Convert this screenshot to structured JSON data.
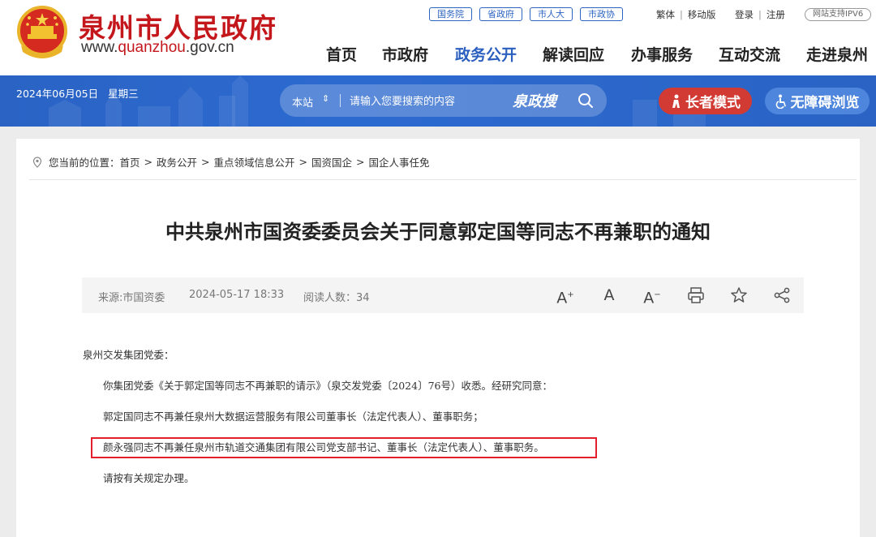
{
  "header": {
    "site_name": "泉州市人民政府",
    "site_url_prefix": "www.",
    "site_url_domain": "quanzhou",
    "site_url_suffix": ".gov.cn",
    "top_links": [
      "国务院",
      "省政府",
      "市人大",
      "市政协"
    ],
    "util_links": {
      "traditional": "繁体",
      "mobile": "移动版",
      "login": "登录",
      "register": "注册",
      "ipv6": "网站支持IPV6"
    },
    "nav": [
      "首页",
      "市政府",
      "政务公开",
      "解读回应",
      "办事服务",
      "互动交流",
      "走进泉州"
    ],
    "active_nav": "政务公开"
  },
  "banner": {
    "date": "2024年06月05日",
    "weekday": "星期三",
    "search": {
      "scope": "本站",
      "placeholder": "请输入您要搜索的内容",
      "brand": "泉政搜"
    },
    "elder_mode": "长者模式",
    "accessibility": "无障碍浏览"
  },
  "breadcrumb": {
    "prefix": "您当前的位置：",
    "items": [
      "首页",
      "政务公开",
      "重点领域信息公开",
      "国资国企",
      "国企人事任免"
    ]
  },
  "article": {
    "title": "中共泉州市国资委委员会关于同意郭定国等同志不再兼职的通知",
    "meta": {
      "source": "来源:市国资委",
      "date": "2024-05-17 18:33",
      "reads": "阅读人数：34"
    },
    "tools": {
      "font_larger": "A",
      "font_normal": "A",
      "font_smaller": "A"
    },
    "paragraphs": [
      "泉州交发集团党委：",
      "你集团党委《关于郭定国等同志不再兼职的请示》（泉交发党委〔2024〕76号）收悉。经研究同意：",
      "郭定国同志不再兼任泉州大数据运营服务有限公司董事长（法定代表人）、董事职务；",
      "颜永强同志不再兼任泉州市轨道交通集团有限公司党支部书记、董事长（法定代表人）、董事职务。",
      "请按有关规定办理。"
    ]
  },
  "colors": {
    "brand_red": "#c4171c",
    "nav_blue": "#2a5fc0",
    "banner_blue": "#2a63c4",
    "elder_red": "#d13b33",
    "highlight_red": "#e3202a"
  }
}
